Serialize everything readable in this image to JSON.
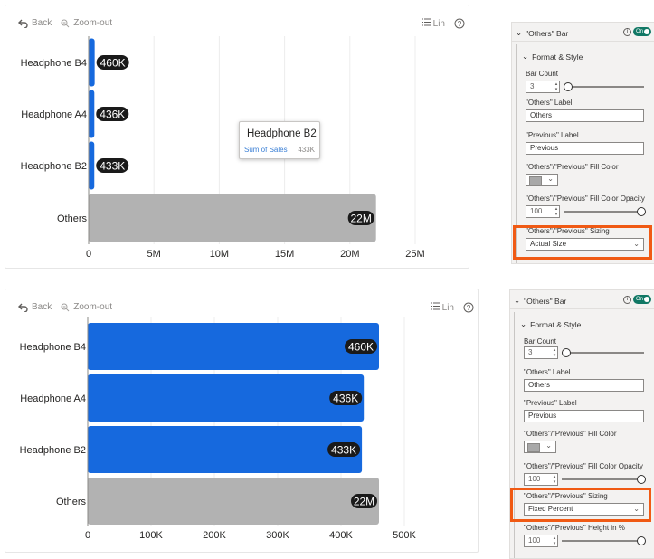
{
  "toolbar": {
    "back_label": "Back",
    "zoom_label": "Zoom-out",
    "scale_label": "Lin",
    "help_label": "?"
  },
  "tooltip": {
    "title": "Headphone B2",
    "measure_label": "Sum of Sales",
    "measure_value": "433K"
  },
  "colors": {
    "primary_bar": "#1669de",
    "others_bar": "#b2b2b2",
    "highlight": "#f05a14",
    "toggle": "#117865"
  },
  "chart_data": [
    {
      "type": "bar",
      "orientation": "horizontal",
      "categories": [
        "Headphone B4",
        "Headphone A4",
        "Headphone B2",
        "Others"
      ],
      "values": [
        460000,
        436000,
        433000,
        22000000
      ],
      "data_labels": [
        "460K",
        "436K",
        "433K",
        "22M"
      ],
      "xlim": [
        0,
        25000000
      ],
      "x_ticks": [
        0,
        5000000,
        10000000,
        15000000,
        20000000,
        25000000
      ],
      "x_tick_labels": [
        "0",
        "5M",
        "10M",
        "15M",
        "20M",
        "25M"
      ],
      "sizing": "Actual Size"
    },
    {
      "type": "bar",
      "orientation": "horizontal",
      "categories": [
        "Headphone B4",
        "Headphone A4",
        "Headphone B2",
        "Others"
      ],
      "values": [
        460000,
        436000,
        433000,
        22000000
      ],
      "data_labels": [
        "460K",
        "436K",
        "433K",
        "22M"
      ],
      "xlim": [
        0,
        500000
      ],
      "x_ticks": [
        0,
        100000,
        200000,
        300000,
        400000,
        500000
      ],
      "x_tick_labels": [
        "0",
        "100K",
        "200K",
        "300K",
        "400K",
        "500K"
      ],
      "sizing": "Fixed Percent",
      "others_display_value": 460000
    }
  ],
  "panel1": {
    "title": "\"Others\" Bar",
    "toggle": "On",
    "section": "Format & Style",
    "bar_count_label": "Bar Count",
    "bar_count_value": "3",
    "others_label_label": "\"Others\" Label",
    "others_label_value": "Others",
    "previous_label_label": "\"Previous\" Label",
    "previous_label_value": "Previous",
    "fill_color_label": "\"Others\"/\"Previous\" Fill Color",
    "opacity_label": "\"Others\"/\"Previous\" Fill Color Opacity",
    "opacity_value": "100",
    "sizing_label": "\"Others\"/\"Previous\" Sizing",
    "sizing_value": "Actual Size"
  },
  "panel2": {
    "title": "\"Others\" Bar",
    "toggle": "On",
    "section": "Format & Style",
    "bar_count_label": "Bar Count",
    "bar_count_value": "3",
    "others_label_label": "\"Others\" Label",
    "others_label_value": "Others",
    "previous_label_label": "\"Previous\" Label",
    "previous_label_value": "Previous",
    "fill_color_label": "\"Others\"/\"Previous\" Fill Color",
    "opacity_label": "\"Others\"/\"Previous\" Fill Color Opacity",
    "opacity_value": "100",
    "sizing_label": "\"Others\"/\"Previous\" Sizing",
    "sizing_value": "Fixed Percent",
    "height_label": "\"Others\"/\"Previous\" Height in %",
    "height_value": "100"
  }
}
